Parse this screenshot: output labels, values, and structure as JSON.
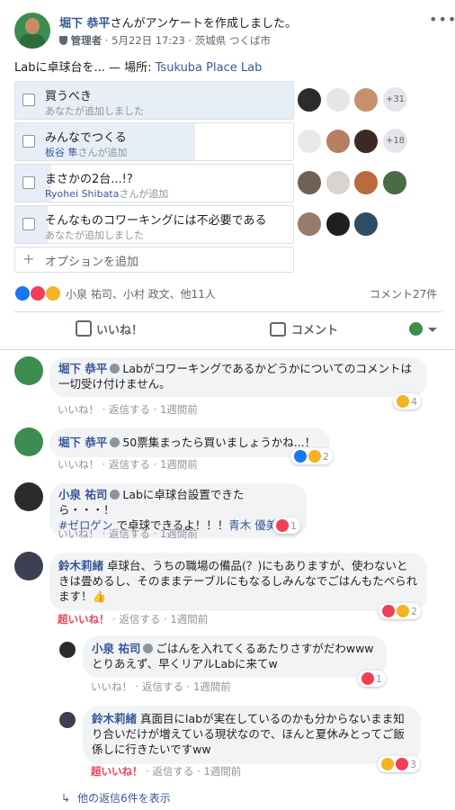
{
  "post": {
    "author": "堀下 恭平",
    "action": "さんがアンケートを作成しました。",
    "role": "管理者",
    "date": "5月22日 17:23",
    "place": "茨城県 つくば市",
    "body_prefix": "Labに卓球台を... — 場所: ",
    "body_place": "Tsukuba Place Lab",
    "more_icon": "ellipsis-icon"
  },
  "poll": {
    "options": [
      {
        "label": "買うべき",
        "sub": "あなたが追加しました",
        "sub_name": "",
        "count": "+31"
      },
      {
        "label": "みんなでつくる",
        "sub": "さんが追加",
        "sub_name": "板谷 隼",
        "count": "+18"
      },
      {
        "label": "まさかの2台...!?",
        "sub": "さんが追加",
        "sub_name": "Ryohei Shibata",
        "count": ""
      },
      {
        "label": "そんなものコワーキングには不必要である",
        "sub": "あなたが追加しました",
        "sub_name": "",
        "count": ""
      }
    ],
    "add_option": "オプションを追加"
  },
  "reactions": {
    "names": "小泉 祐司、小村 政文、他11人",
    "comment_count": "コメント27件"
  },
  "actions": {
    "like": "いいね！",
    "comment": "コメント"
  },
  "comments": [
    {
      "name": "堀下 恭平",
      "text": "Labがコワーキングであるかどうかについてのコメントは一切受け付けません。",
      "like": "いいね！",
      "reply": "返信する",
      "time": "1週間前",
      "react_count": "4"
    },
    {
      "name": "堀下 恭平",
      "text": "50票集まったら買いましょうかね...！",
      "like": "いいね！",
      "reply": "返信する",
      "time": "1週間前",
      "react_count": "2"
    },
    {
      "name": "小泉 祐司",
      "text1": "Labに卓球台設置できたら・・・！",
      "hashtag": "#ゼロゲン",
      "text2": " で卓球できるよ！！！",
      "mention": "青木 優美",
      "text3": "！",
      "like": "いいね！",
      "reply": "返信する",
      "time": "1週間前",
      "react_count": "1"
    },
    {
      "name": "鈴木莉緒",
      "text": "卓球台、うちの職場の備品(？)にもありますが、使わないときは畳めるし、そのままテーブルにもなるしみんなでごはんもたべられます！👍",
      "like": "超いいね！",
      "reply": "返信する",
      "time": "1週間前",
      "react_count": "2"
    }
  ],
  "replies": [
    {
      "name": "小泉 祐司",
      "text": "ごはんを入れてくるあたりさすがだわwww とりあえず、早くリアルLabに来てw",
      "like": "いいね！",
      "reply": "返信する",
      "time": "1週間前",
      "react_count": "1"
    },
    {
      "name": "鈴木莉緒",
      "text": "真面目にlabが実在しているのかも分からないまま知り合いだけが増えている現状なので、ほんと夏休みとってご飯係しに行きたいですww",
      "like": "超いいね！",
      "reply": "返信する",
      "time": "1週間前",
      "react_count": "3"
    }
  ],
  "more_replies": "他の返信6件を表示",
  "colors": {
    "link": "#385898",
    "gray": "#90949c",
    "love": "#f33e58",
    "like": "#1877f2",
    "haha": "#f7b125"
  }
}
